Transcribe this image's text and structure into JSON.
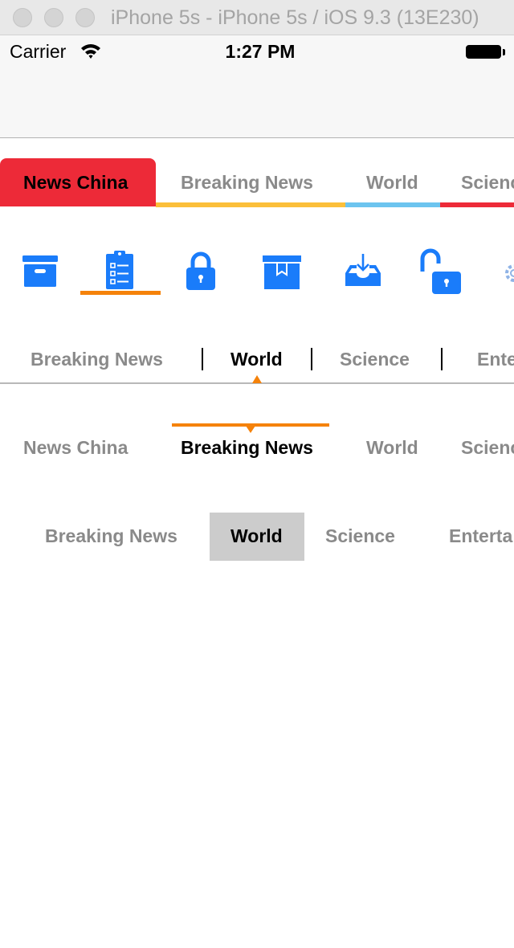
{
  "window": {
    "title": "iPhone 5s - iPhone 5s / iOS 9.3 (13E230)"
  },
  "status_bar": {
    "carrier": "Carrier",
    "time": "1:27 PM"
  },
  "row1": {
    "tabs": [
      "News China",
      "Breaking News",
      "World",
      "Scienc"
    ],
    "active_index": 0,
    "active_color": "#ed2a38",
    "indicator_colors": [
      "#ed2a38",
      "#fbbf3a",
      "#6cc4ef",
      "#ed2a38"
    ]
  },
  "row2": {
    "icons": [
      "archive-box-icon",
      "clipboard-list-icon",
      "lock-icon",
      "archive-bookmark-icon",
      "inbox-download-icon",
      "unlock-icon",
      "gear-icon"
    ],
    "active_index": 1,
    "icon_color": "#1a7cfa",
    "indicator_color": "#f5820a"
  },
  "row3": {
    "tabs": [
      "Breaking News",
      "World",
      "Science",
      "Ente"
    ],
    "active_index": 1,
    "indicator_color": "#f5820a"
  },
  "row4": {
    "tabs": [
      "News China",
      "Breaking News",
      "World",
      "Scienc"
    ],
    "active_index": 1,
    "indicator_color": "#f5820a"
  },
  "row5": {
    "tabs": [
      "Breaking News",
      "World",
      "Science",
      "Enterta"
    ],
    "active_index": 1,
    "active_bg": "#cccccc"
  }
}
